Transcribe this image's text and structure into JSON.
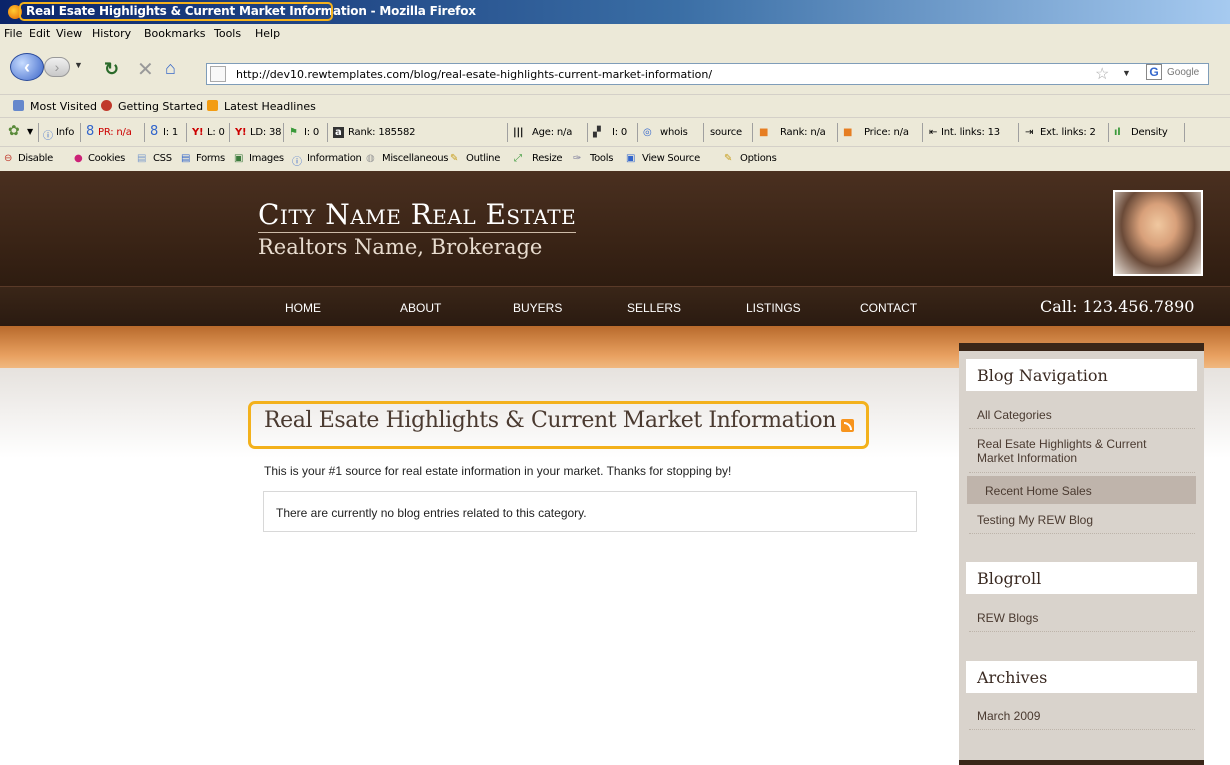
{
  "window": {
    "title": "Real Esate Highlights & Current Market Information - Mozilla Firefox"
  },
  "menu": [
    "File",
    "Edit",
    "View",
    "History",
    "Bookmarks",
    "Tools",
    "Help"
  ],
  "navbar": {
    "url": "http://dev10.rewtemplates.com/blog/real-esate-highlights-current-market-information/",
    "search_placeholder": "Google"
  },
  "bookmarks": [
    "Most Visited",
    "Getting Started",
    "Latest Headlines"
  ],
  "seo_toolbar": {
    "info": "Info",
    "pr": "PR: n/a",
    "i1": "I: 1",
    "l": "L: 0",
    "ld": "LD: 38",
    "i0a": "I: 0",
    "rank": "Rank: 185582",
    "age": "Age: n/a",
    "i0b": "I: 0",
    "whois": "whois",
    "source": "source",
    "rank2": "Rank: n/a",
    "price": "Price: n/a",
    "int_links": "Int. links: 13",
    "ext_links": "Ext. links: 2",
    "density": "Density"
  },
  "dev_toolbar": [
    "Disable",
    "Cookies",
    "CSS",
    "Forms",
    "Images",
    "Information",
    "Miscellaneous",
    "Outline",
    "Resize",
    "Tools",
    "View Source",
    "Options"
  ],
  "site": {
    "title": "City Name Real Estate",
    "subtitle": "Realtors Name, Brokerage",
    "nav": [
      "HOME",
      "ABOUT",
      "BUYERS",
      "SELLERS",
      "LISTINGS",
      "CONTACT"
    ],
    "phone": "Call: 123.456.7890"
  },
  "content": {
    "heading": "Real Esate Highlights & Current Market Information",
    "description": "This is your #1 source for real estate information in your market.  Thanks for stopping by!",
    "no_entries": "There are currently no blog entries related to this category."
  },
  "sidebar": {
    "nav_heading": "Blog Navigation",
    "nav_items": [
      "All Categories",
      "Real Esate Highlights & Current Market Information",
      "Recent Home Sales",
      "Testing My REW Blog"
    ],
    "blogroll_heading": "Blogroll",
    "blogroll_items": [
      "REW Blogs"
    ],
    "archives_heading": "Archives",
    "archives_items": [
      "March 2009"
    ]
  },
  "colors": {
    "header_brown": "#3a2416",
    "accent_orange": "#e8a060",
    "highlight": "#f3b11c"
  }
}
